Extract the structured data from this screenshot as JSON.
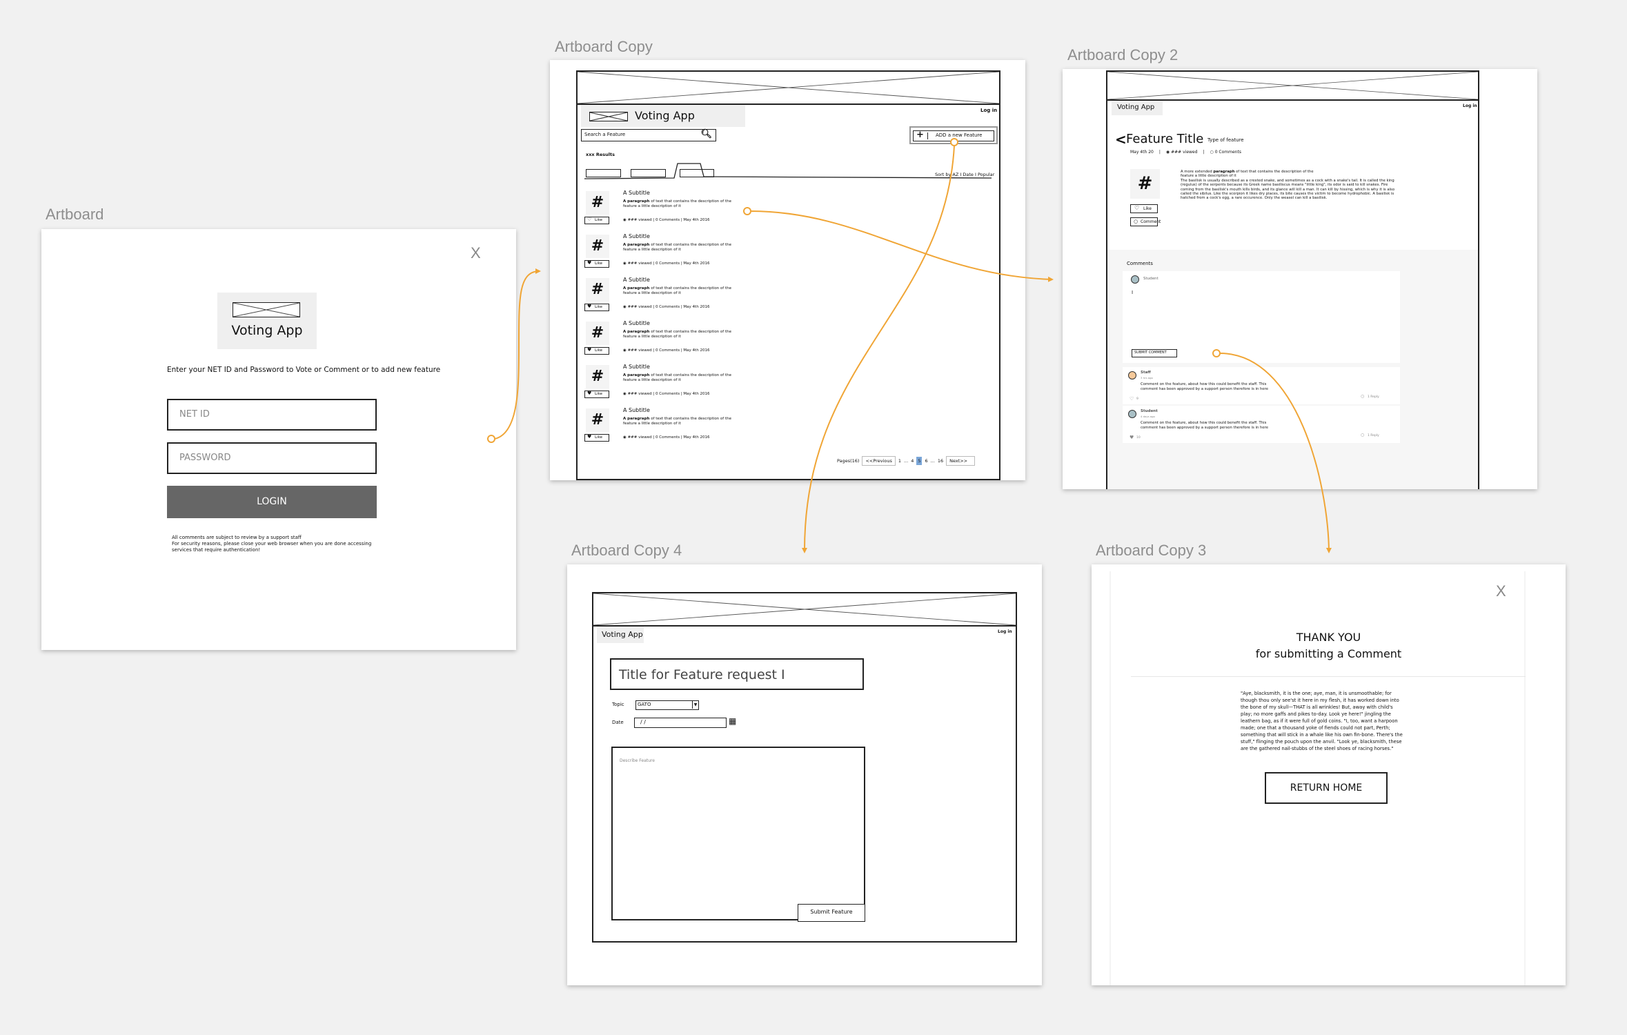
{
  "canvas": {
    "accent_color": "#f0a535",
    "artboard_labels": [
      "Artboard",
      "Artboard Copy",
      "Artboard Copy 2",
      "Artboard Copy 4",
      "Artboard Copy 3"
    ]
  },
  "login": {
    "close": "X",
    "brand": "Voting App",
    "instruction": "Enter your NET ID and Password to Vote or Comment or to add new feature",
    "netid_placeholder": "NET ID",
    "password_placeholder": "PASSWORD",
    "login_label": "LOGIN",
    "notice_lines": [
      "All comments are subject to review by a support staff",
      "For security reasons, please close your web browser when you are done accessing",
      "services that require authentication!"
    ]
  },
  "list": {
    "brand": "Voting App",
    "login_link": "Log in",
    "search_placeholder": "Search a Feature",
    "add_label": "ADD a new Feature",
    "results": "xxx Results",
    "sort": "Sort by AZ I Date I Popular",
    "items": [
      {
        "subtitle": "A Subtitle",
        "para_bold": "A paragraph",
        "para_rest": " of text that contains the description of the",
        "para_line2": "feature a little description of it",
        "like": "Like",
        "liked": false,
        "meta": "### viewed | 0 Comments | May 4th 2016"
      },
      {
        "subtitle": "A Subtitle",
        "para_bold": "A paragraph",
        "para_rest": " of text that contains the description of the",
        "para_line2": "feature a little description of it",
        "like": "Like",
        "liked": true,
        "meta": "### viewed | 0 Comments | May 4th 2016"
      },
      {
        "subtitle": "A Subtitle",
        "para_bold": "A paragraph",
        "para_rest": " of text that contains the description of the",
        "para_line2": "feature a little description of it",
        "like": "Like",
        "liked": true,
        "meta": "### viewed | 0 Comments | May 4th 2016"
      },
      {
        "subtitle": "A Subtitle",
        "para_bold": "A paragraph",
        "para_rest": " of text that contains the description of the",
        "para_line2": "feature a little description of it",
        "like": "Like",
        "liked": true,
        "meta": "### viewed | 0 Comments | May 4th 2016"
      },
      {
        "subtitle": "A Subtitle",
        "para_bold": "A paragraph",
        "para_rest": " of text that contains the description of the",
        "para_line2": "feature a little description of it",
        "like": "Like",
        "liked": true,
        "meta": "### viewed | 0 Comments | May 4th 2016"
      },
      {
        "subtitle": "A Subtitle",
        "para_bold": "A paragraph",
        "para_rest": " of text that contains the description of the",
        "para_line2": "feature a little description of it",
        "like": "Like",
        "liked": true,
        "meta": "### viewed | 0 Comments | May 4th 2016"
      }
    ],
    "pagination": {
      "label": "Pages(16)",
      "prev": "<<Previous",
      "pages": [
        "1",
        "...",
        "4",
        "5",
        "6",
        "...",
        "16"
      ],
      "current": "5",
      "next": "Next>>"
    }
  },
  "detail": {
    "brand": "Voting App",
    "login_link": "Log in",
    "title": "Feature Title",
    "type": "Type of feature",
    "meta_date": "May 4th 20",
    "meta_views": "### viewed",
    "meta_comments": "0 Comments",
    "para_intro_pre": "A more extended ",
    "para_intro_bold": "paragraph",
    "para_intro_post": " of text that contains the description of the",
    "para_line2": "feature a little description of it",
    "para_body": "The basilisk is usually described as a crested snake, and sometimes as a cock with a snake's tail. It is called the king (regulus) of the serpents because its Greek name basiliscus means \"little king\", its odor is said to kill snakes. Fire coming from the basilisk's mouth kills birds, and its glance will kill a man. It can kill by hissing, which is why it is also called the sibilus. Like the scorpion it likes dry places, its bite causes the victim to become hydrophobic. A basilisk is hatched from a cock's egg, a rare occurence. Only the weasel can kill a basilisk.",
    "like": "Like",
    "comment": "Comment",
    "comments_heading": "Comments",
    "composer_user": "Student",
    "composer_value": "I",
    "submit_comment": "SUBMIT COMMENT",
    "comments": [
      {
        "user": "Staff",
        "time": "3 hrs ago",
        "text1": "Comment on the feature, about how this could benefit the staff. This",
        "text2": "comment has been approved by a support person therefore is in here",
        "likes": "9",
        "liked": false,
        "reply": "1 Reply",
        "avatar": "#f5c99a"
      },
      {
        "user": "Student",
        "time": "4 days ago",
        "text1": "Comment on the feature, about how this could benefit the staff. This",
        "text2": "comment has been approved by a support person therefore is in here",
        "likes": "10",
        "liked": true,
        "reply": "1 Reply",
        "avatar": "#a9c0c6"
      }
    ]
  },
  "newfeature": {
    "brand": "Voting App",
    "login_link": "Log in",
    "title_value": "Title for Feature request  I",
    "topic_label": "Topic",
    "topic_value": "GATO",
    "date_label": "Date",
    "date_value": "/ /",
    "describe_placeholder": "Describe Feature",
    "submit": "Submit Feature"
  },
  "thanks": {
    "close": "X",
    "heading": "THANK YOU",
    "subheading": "for submitting a Comment",
    "quote_lines": [
      "\"Aye, blacksmith, it is the one; aye, man, it is unsmoothable; for",
      "though thou only see'st it here in my flesh, it has worked down into",
      "the bone of my skull—THAT is all wrinkles! But, away with child's",
      "play; no more gaffs and pikes to-day. Look ye here!\" jingling the",
      "leathern bag, as if it were full of gold coins. \"I, too, want a harpoon",
      "made; one that a thousand yoke of fiends could not part, Perth;",
      "something that will stick in a whale like his own fin-bone. There's the",
      "stuff,\" flinging the pouch upon the anvil. \"Look ye, blacksmith, these",
      "are the gathered nail-stubbs of the steel shoes of racing horses.\""
    ],
    "return_home": "RETURN HOME"
  }
}
